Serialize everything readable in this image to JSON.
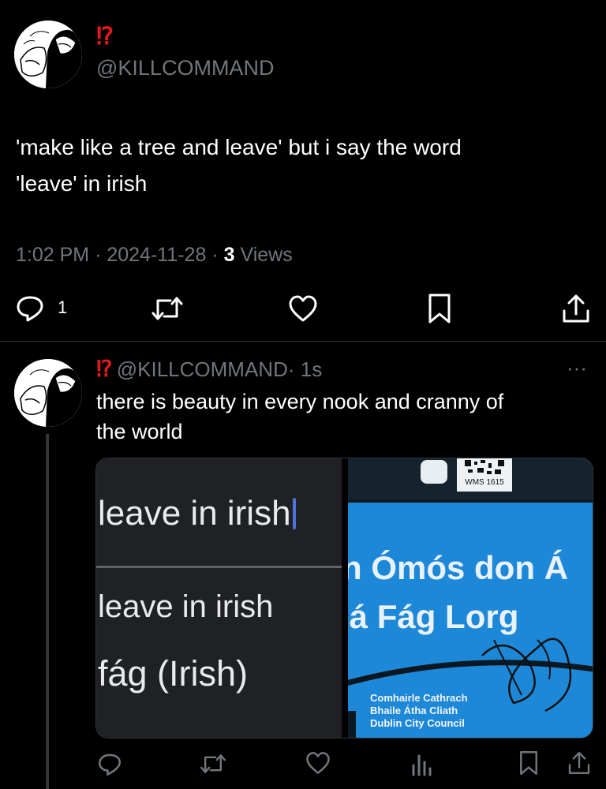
{
  "main_tweet": {
    "display_name": "⁉",
    "handle": "@KILLCOMMAND",
    "text_line1": "'make like a tree and leave' but i say the word",
    "text_line2": "'leave' in irish",
    "time": "1:02 PM",
    "sep1": "·",
    "date": "2024-11-28",
    "sep2": "·",
    "views_count": "3",
    "views_label": "Views",
    "reply_count": "1"
  },
  "reply_tweet": {
    "display_name": "⁉",
    "handle": "@KILLCOMMAND",
    "time_ago": "· 1s",
    "more": "···",
    "text_line1": "there is beauty in every nook and cranny of",
    "text_line2": "the world",
    "media_left": {
      "search_query": "leave in irish",
      "suggestion": "leave in irish",
      "result": "fág (Irish)"
    },
    "media_right": {
      "qr_label": "WMS 1615",
      "sign_line1": "n Ómós don Á",
      "sign_line2": "lá Fág Lorg",
      "council_line1": "Comhairle Cathrach",
      "council_line2": "Bhaile Átha Cliath",
      "council_line3": "Dublin City Council"
    }
  },
  "colors": {
    "background": "#000000",
    "muted_text": "#71767b",
    "red_mark": "#e0191e",
    "sign_blue": "#1e88d8",
    "search_panel": "#202124",
    "cursor_blue": "#4a74d8"
  }
}
